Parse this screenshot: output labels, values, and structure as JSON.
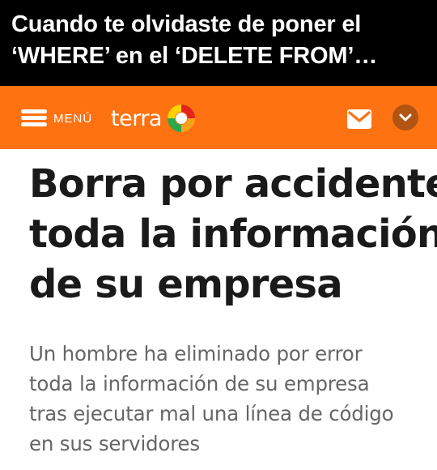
{
  "caption": {
    "line1": "Cuando te olvidaste de poner el",
    "line2": "‘WHERE’ en el ‘DELETE FROM’…"
  },
  "header": {
    "menu_label": "MENÚ",
    "logo_text": "terra",
    "background": "#ff7212",
    "icons": [
      "menu-icon",
      "terra-logo",
      "mail-icon",
      "chevron-down-icon"
    ]
  },
  "article": {
    "headline_lines": [
      "Borra por accidente",
      "toda la información",
      "de su empresa"
    ],
    "summary_lines": [
      "Un hombre ha eliminado por error",
      "toda la información de su empresa",
      "tras ejecutar mal una línea de código",
      "en sus servidores"
    ]
  }
}
